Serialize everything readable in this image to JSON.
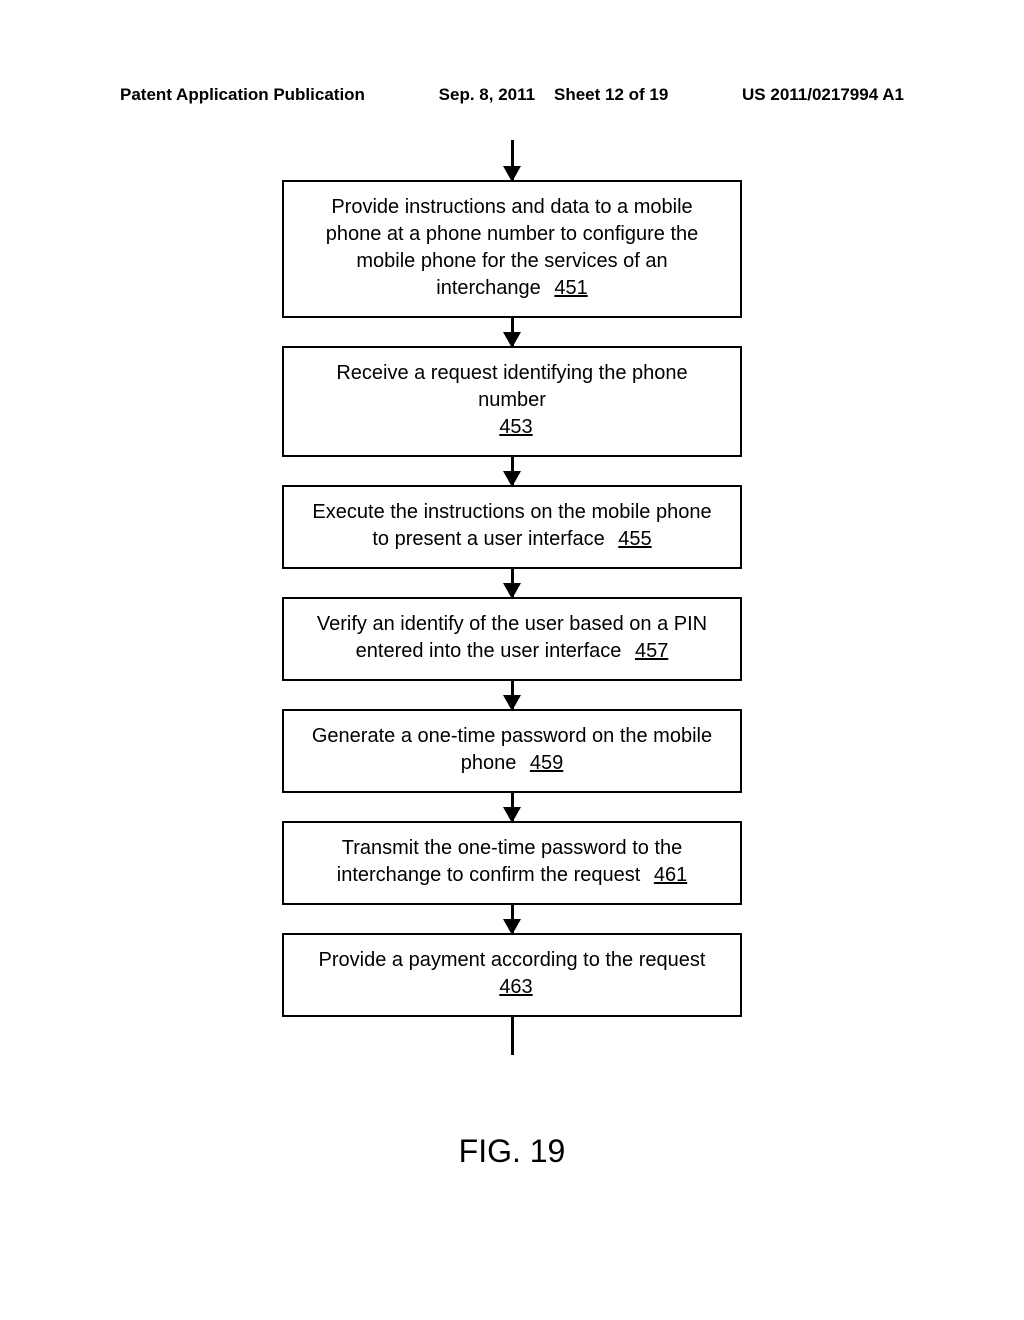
{
  "header": {
    "left": "Patent Application Publication",
    "date": "Sep. 8, 2011",
    "sheet": "Sheet 12 of 19",
    "docnum": "US 2011/0217994 A1"
  },
  "steps": [
    {
      "text": "Provide instructions and data to a mobile phone at a phone number to configure the mobile phone for the services of an interchange",
      "ref": "451"
    },
    {
      "text": "Receive a request identifying the phone number",
      "ref": "453"
    },
    {
      "text": "Execute the instructions on the mobile phone to present a user interface",
      "ref": "455"
    },
    {
      "text": "Verify an identify of the user based on a PIN entered into the user interface",
      "ref": "457"
    },
    {
      "text": "Generate a one-time password on the mobile phone",
      "ref": "459"
    },
    {
      "text": "Transmit the one-time password to the interchange to confirm the request",
      "ref": "461"
    },
    {
      "text": "Provide a payment according to the request",
      "ref": "463"
    }
  ],
  "figure_label": "FIG. 19"
}
